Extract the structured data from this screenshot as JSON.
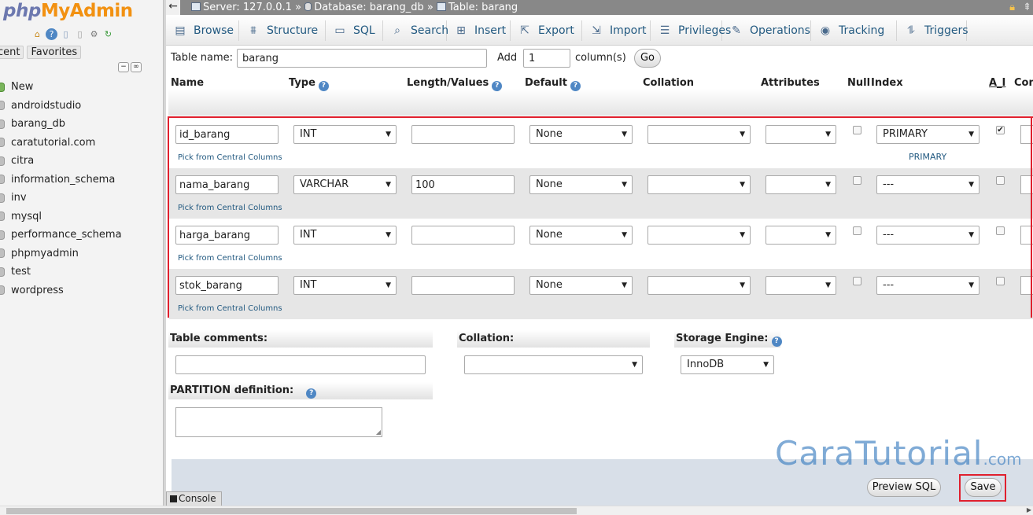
{
  "logo": {
    "php": "php",
    "myadmin": "MyAdmin"
  },
  "nav": {
    "tabs": [
      "cent",
      "Favorites"
    ],
    "icons": [
      "home-icon",
      "help-icon",
      "docs-icon",
      "settings-icon",
      "reload-icon"
    ],
    "databases": [
      {
        "label": "New"
      },
      {
        "label": "androidstudio"
      },
      {
        "label": "barang_db"
      },
      {
        "label": "caratutorial.com"
      },
      {
        "label": "citra"
      },
      {
        "label": "information_schema"
      },
      {
        "label": "inv"
      },
      {
        "label": "mysql"
      },
      {
        "label": "performance_schema"
      },
      {
        "label": "phpmyadmin"
      },
      {
        "label": "test"
      },
      {
        "label": "wordpress"
      }
    ]
  },
  "breadcrumb": {
    "server": "Server: 127.0.0.1",
    "sep": "»",
    "database": "Database: barang_db",
    "table": "Table: barang"
  },
  "menu": [
    {
      "label": "Browse",
      "icon": "browse-icon",
      "glyph": "▤"
    },
    {
      "label": "Structure",
      "icon": "structure-icon",
      "glyph": "⩩"
    },
    {
      "label": "SQL",
      "icon": "sql-icon",
      "glyph": "▭"
    },
    {
      "label": "Search",
      "icon": "search-icon",
      "glyph": "⌕"
    },
    {
      "label": "Insert",
      "icon": "insert-icon",
      "glyph": "⊞"
    },
    {
      "label": "Export",
      "icon": "export-icon",
      "glyph": "⇱"
    },
    {
      "label": "Import",
      "icon": "import-icon",
      "glyph": "⇲"
    },
    {
      "label": "Privileges",
      "icon": "privileges-icon",
      "glyph": "☰"
    },
    {
      "label": "Operations",
      "icon": "wrench-icon",
      "glyph": "✎"
    },
    {
      "label": "Tracking",
      "icon": "eye-icon",
      "glyph": "◉"
    },
    {
      "label": "Triggers",
      "icon": "triggers-icon",
      "glyph": "⥮"
    }
  ],
  "table_form": {
    "table_name_label": "Table name:",
    "table_name_value": "barang",
    "add_label": "Add",
    "add_count": "1",
    "columns_label": "column(s)",
    "go_label": "Go"
  },
  "columns_header": {
    "name": "Name",
    "type": "Type",
    "length": "Length/Values",
    "default": "Default",
    "collation": "Collation",
    "attributes": "Attributes",
    "null": "Null",
    "index": "Index",
    "ai": "A_I",
    "comments": "Com"
  },
  "pick_link": "Pick from Central Columns",
  "rows": [
    {
      "name": "id_barang",
      "type": "INT",
      "length": "",
      "default": "None",
      "collation": "",
      "attributes": "",
      "null": false,
      "index": "PRIMARY",
      "index_note": "PRIMARY",
      "ai": true
    },
    {
      "name": "nama_barang",
      "type": "VARCHAR",
      "length": "100",
      "default": "None",
      "collation": "",
      "attributes": "",
      "null": false,
      "index": "---",
      "index_note": "",
      "ai": false
    },
    {
      "name": "harga_barang",
      "type": "INT",
      "length": "",
      "default": "None",
      "collation": "",
      "attributes": "",
      "null": false,
      "index": "---",
      "index_note": "",
      "ai": false
    },
    {
      "name": "stok_barang",
      "type": "INT",
      "length": "",
      "default": "None",
      "collation": "",
      "attributes": "",
      "null": false,
      "index": "---",
      "index_note": "",
      "ai": false
    }
  ],
  "options": {
    "table_comments_label": "Table comments:",
    "table_comments_value": "",
    "collation_label": "Collation:",
    "collation_value": "",
    "engine_label": "Storage Engine:",
    "engine_value": "InnoDB",
    "partition_label": "PARTITION definition:",
    "partition_value": ""
  },
  "footer": {
    "preview_sql_label": "Preview SQL",
    "save_label": "Save",
    "console_label": "Console"
  },
  "watermark": {
    "main": "CaraTutorial",
    "suffix": ".com"
  },
  "colors": {
    "highlight_border": "#e0202e",
    "link": "#235a81",
    "logo_orange": "#f29111",
    "logo_blue": "#6c78af"
  }
}
